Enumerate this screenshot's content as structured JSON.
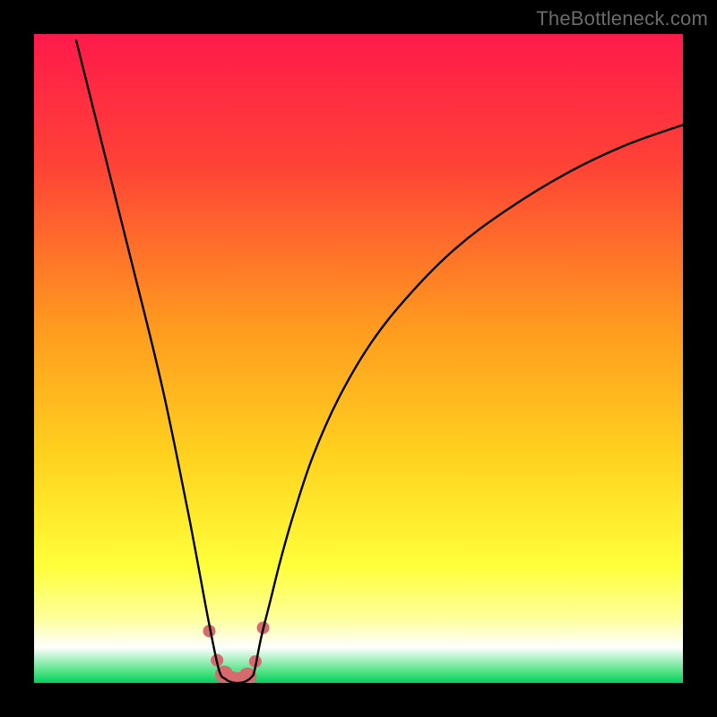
{
  "watermark": "TheBottleneck.com",
  "chart_data": {
    "type": "line",
    "title": "",
    "xlabel": "",
    "ylabel": "",
    "xlim": [
      0,
      100
    ],
    "ylim": [
      0,
      100
    ],
    "gradient_stops": [
      {
        "offset": 0.0,
        "color": "#ff1a4b"
      },
      {
        "offset": 0.2,
        "color": "#ff4236"
      },
      {
        "offset": 0.45,
        "color": "#ff9a1f"
      },
      {
        "offset": 0.65,
        "color": "#ffd21f"
      },
      {
        "offset": 0.82,
        "color": "#ffff3a"
      },
      {
        "offset": 0.9,
        "color": "#feff9a"
      },
      {
        "offset": 0.945,
        "color": "#ffffff"
      },
      {
        "offset": 0.985,
        "color": "#47e07d"
      },
      {
        "offset": 1.0,
        "color": "#00d062"
      }
    ],
    "series": [
      {
        "name": "left-branch",
        "x": [
          6.5,
          8,
          10,
          12,
          14,
          16,
          18,
          20,
          22,
          24,
          25.5,
          27,
          28.5
        ],
        "y": [
          99,
          93,
          85,
          77,
          69,
          61,
          53,
          44.5,
          35,
          25,
          17,
          9,
          2
        ]
      },
      {
        "name": "right-branch",
        "x": [
          34,
          35,
          36.5,
          38,
          40,
          43,
          47,
          52,
          58,
          65,
          73,
          82,
          91,
          100
        ],
        "y": [
          2,
          7,
          13,
          19,
          26,
          35,
          44,
          52.5,
          60,
          67,
          73,
          78.5,
          82.8,
          86
        ]
      },
      {
        "name": "valley",
        "x": [
          28.5,
          29.5,
          30.5,
          31.5,
          32.5,
          33.5,
          34
        ],
        "y": [
          2,
          0.6,
          0.1,
          0,
          0.2,
          0.9,
          2
        ]
      }
    ],
    "markers": {
      "name": "valley-markers",
      "color": "#d66a6d",
      "radius_small": 7,
      "radius_large": 10,
      "points": [
        {
          "x": 27.0,
          "y": 8.0,
          "r": "small"
        },
        {
          "x": 28.2,
          "y": 3.5,
          "r": "small"
        },
        {
          "x": 29.3,
          "y": 1.3,
          "r": "large"
        },
        {
          "x": 30.5,
          "y": 0.4,
          "r": "large"
        },
        {
          "x": 31.7,
          "y": 0.3,
          "r": "large"
        },
        {
          "x": 32.9,
          "y": 1.0,
          "r": "large"
        },
        {
          "x": 34.1,
          "y": 3.3,
          "r": "small"
        },
        {
          "x": 35.3,
          "y": 8.5,
          "r": "small"
        }
      ]
    }
  }
}
